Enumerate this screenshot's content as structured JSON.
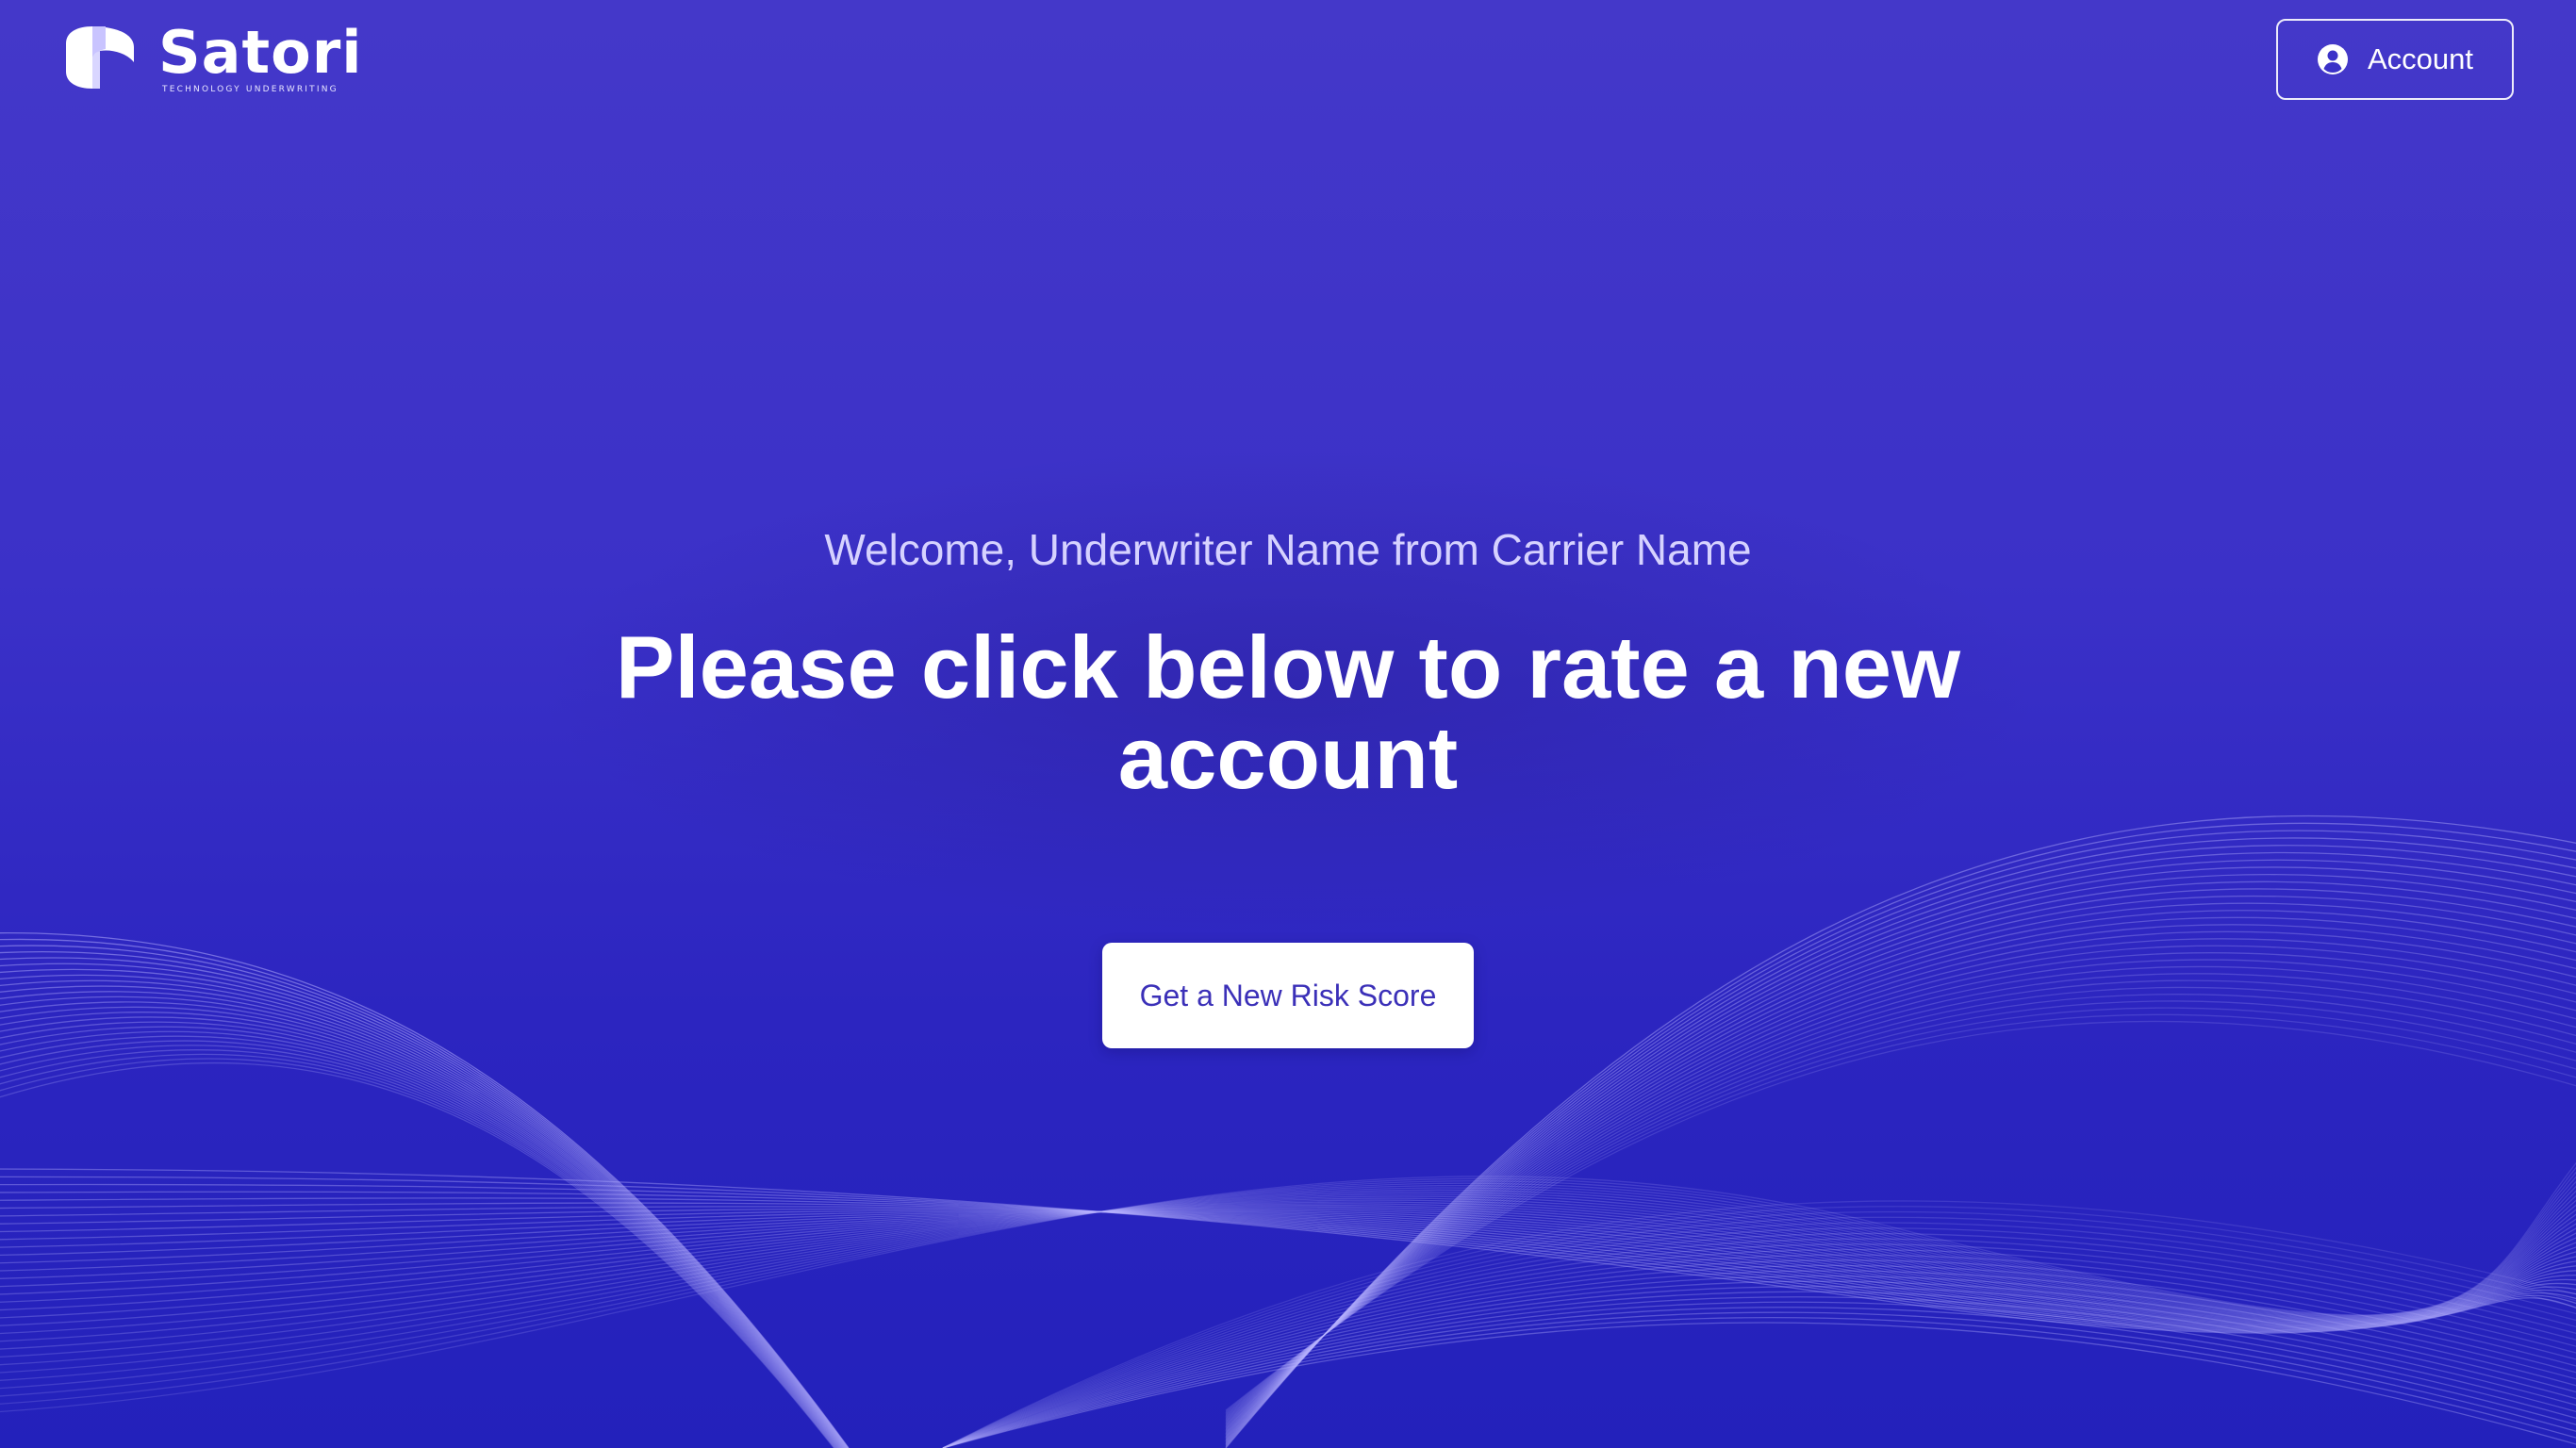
{
  "brand": {
    "name": "Satori",
    "tagline": "TECHNOLOGY UNDERWRITING",
    "logo_icon": "satori-logo-icon"
  },
  "header": {
    "account_label": "Account",
    "account_icon": "user-circle-icon"
  },
  "main": {
    "welcome": "Welcome, Underwriter Name from Carrier Name",
    "headline": "Please click below to rate a new account",
    "cta_label": "Get a New Risk Score"
  },
  "colors": {
    "background_top": "#4438c9",
    "background_bottom": "#2321bb",
    "cta_text": "#3b30b8",
    "welcome_text": "#d6d2ff"
  }
}
